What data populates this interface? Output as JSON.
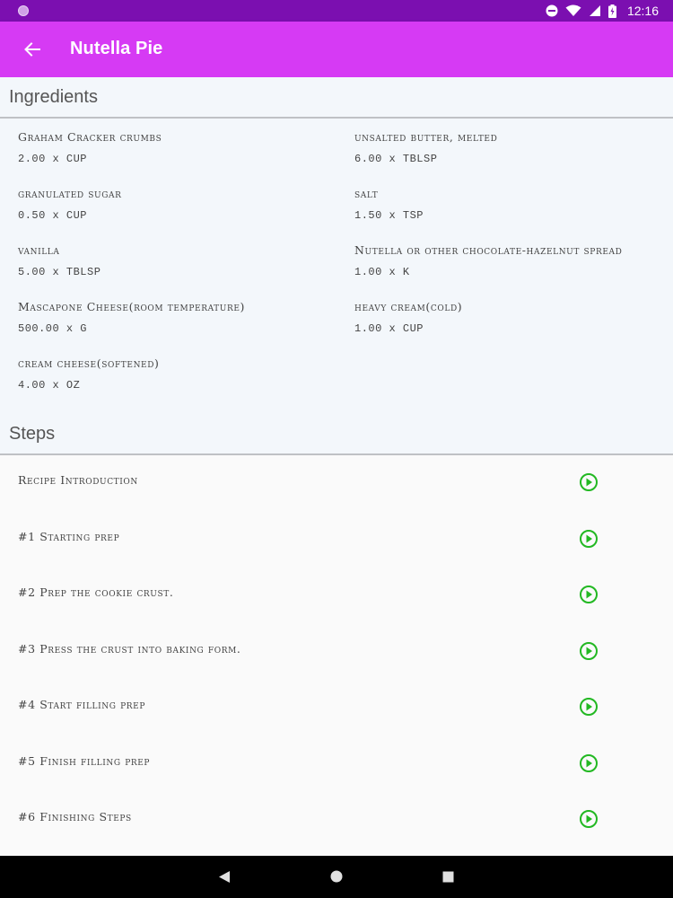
{
  "status_bar": {
    "time": "12:16",
    "icons": [
      "notification-dot-icon",
      "do-not-disturb-icon",
      "wifi-icon",
      "signal-icon",
      "battery-icon"
    ]
  },
  "app_bar": {
    "title": "Nutella Pie",
    "back_icon": "arrow-back-icon",
    "color": "#d63af4"
  },
  "ingredients": {
    "title": "Ingredients",
    "items": [
      {
        "name": "Graham Cracker crumbs",
        "qty": "2.00 x CUP"
      },
      {
        "name": "unsalted butter, melted",
        "qty": "6.00 x TBLSP"
      },
      {
        "name": "granulated sugar",
        "qty": "0.50 x CUP"
      },
      {
        "name": "salt",
        "qty": "1.50 x TSP"
      },
      {
        "name": "vanilla",
        "qty": "5.00 x TBLSP"
      },
      {
        "name": "Nutella or other chocolate-hazelnut spread",
        "qty": "1.00 x K"
      },
      {
        "name": "Mascapone Cheese(room temperature)",
        "qty": "500.00 x G"
      },
      {
        "name": "heavy cream(cold)",
        "qty": "1.00 x CUP"
      },
      {
        "name": "cream cheese(softened)",
        "qty": "4.00 x OZ"
      }
    ]
  },
  "steps": {
    "title": "Steps",
    "play_icon_color": "#22b822",
    "items": [
      {
        "label": "Recipe Introduction"
      },
      {
        "label": "#1 Starting prep"
      },
      {
        "label": "#2 Prep the cookie crust."
      },
      {
        "label": "#3 Press the crust into baking form."
      },
      {
        "label": "#4 Start filling prep"
      },
      {
        "label": "#5 Finish filling prep"
      },
      {
        "label": "#6 Finishing Steps"
      }
    ]
  },
  "nav_bar": {
    "icons": [
      "nav-back-icon",
      "nav-home-icon",
      "nav-recents-icon"
    ]
  }
}
